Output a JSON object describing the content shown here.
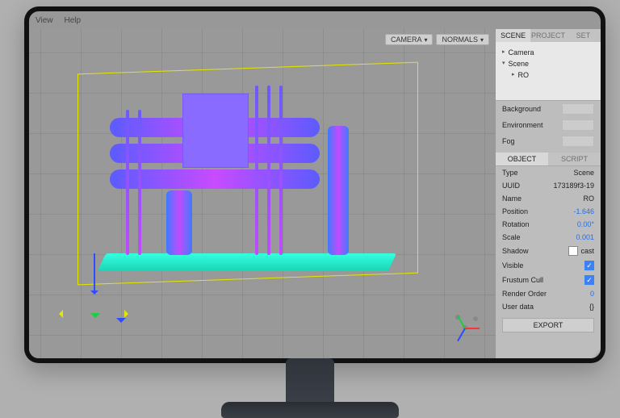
{
  "menu": {
    "view": "View",
    "help": "Help"
  },
  "viewport_controls": {
    "camera": "CAMERA",
    "shading": "NORMALS"
  },
  "side_tabs": {
    "scene": "SCENE",
    "project": "PROJECT",
    "settings": "SET"
  },
  "tree": {
    "camera": "Camera",
    "scene": "Scene",
    "ro": "RO"
  },
  "env": {
    "background": "Background",
    "environment": "Environment",
    "fog": "Fog"
  },
  "obj_tabs": {
    "object": "OBJECT",
    "script": "SCRIPT"
  },
  "props": {
    "type_lbl": "Type",
    "type_val": "Scene",
    "uuid_lbl": "UUID",
    "uuid_val": "173189f3-19",
    "name_lbl": "Name",
    "name_val": "RO",
    "pos_lbl": "Position",
    "pos_val": "-1.646",
    "rot_lbl": "Rotation",
    "rot_val": "0.00°",
    "scale_lbl": "Scale",
    "scale_val": "0.001",
    "shadow_lbl": "Shadow",
    "shadow_opt": "cast",
    "visible_lbl": "Visible",
    "frustum_lbl": "Frustum Cull",
    "render_lbl": "Render Order",
    "render_val": "0",
    "userdata_lbl": "User data",
    "userdata_val": "{}"
  },
  "export": "EXPORT"
}
